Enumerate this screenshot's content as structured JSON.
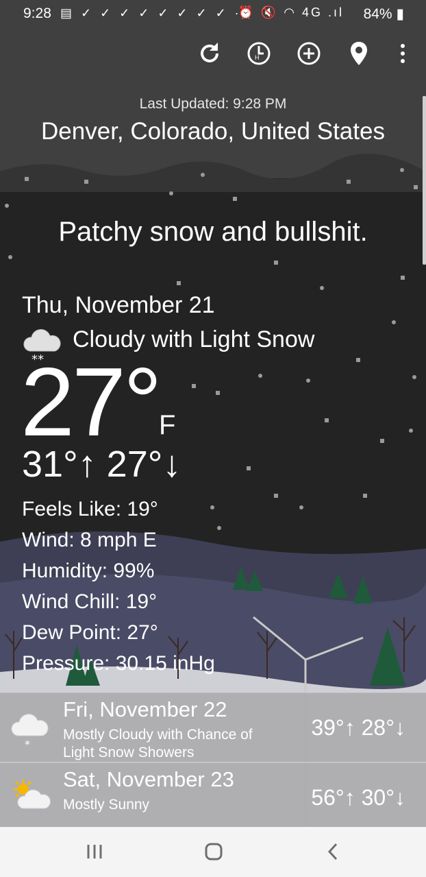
{
  "status_bar": {
    "time": "9:28",
    "notification_icons": "▤ ✓ ✓ ✓ ✓ ✓ ✓ ✓ ✓ ···",
    "system_icons": "⏰ 🔇 ◠ 4G .ıl",
    "battery": "84%"
  },
  "toolbar": {
    "icons": [
      "refresh-icon",
      "history-icon",
      "add-icon",
      "location-pin-icon",
      "more-vert-icon"
    ]
  },
  "header": {
    "last_updated": "Last Updated: 9:28 PM",
    "location": "Denver, Colorado, United States"
  },
  "tagline": "Patchy snow and bullshit.",
  "current": {
    "date": "Thu, November 21",
    "condition": "Cloudy with Light Snow",
    "condition_icon": "cloud-snow-icon",
    "temp": "27°",
    "unit": "F",
    "hilo": "31°↑ 27°↓",
    "details": [
      "Feels Like: 19°",
      "Wind: 8 mph E",
      "Humidity: 99%",
      "Wind Chill: 19°",
      "Dew Point: 27°",
      "Pressure: 30.15 inHg"
    ]
  },
  "forecast": [
    {
      "date": "Fri, November 22",
      "desc": "Mostly Cloudy with Chance of Light Snow Showers",
      "hilo": "39°↑ 28°↓",
      "icon": "cloud-snow-icon"
    },
    {
      "date": "Sat, November 23",
      "desc": "Mostly Sunny",
      "hilo": "56°↑ 30°↓",
      "icon": "sun-cloud-icon"
    }
  ],
  "navbar": {
    "icons": [
      "recents-icon",
      "home-icon",
      "back-icon"
    ]
  }
}
